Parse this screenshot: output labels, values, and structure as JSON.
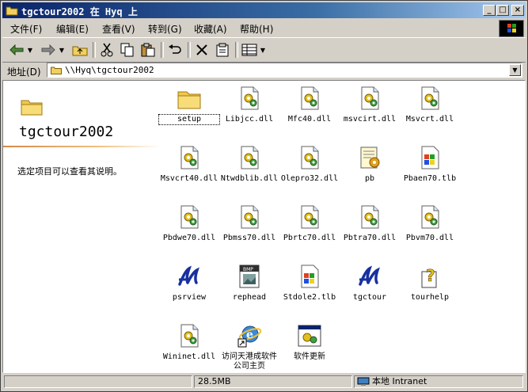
{
  "window": {
    "title": "tgctour2002 在 Hyq 上"
  },
  "menubar": {
    "items": [
      "文件(F)",
      "编辑(E)",
      "查看(V)",
      "转到(G)",
      "收藏(A)",
      "帮助(H)"
    ]
  },
  "address": {
    "label": "地址(D)",
    "path": "\\\\Hyq\\tgctour2002"
  },
  "leftpane": {
    "title": "tgctour2002",
    "description": "选定项目可以查看其说明。"
  },
  "files": [
    {
      "name": "setup",
      "icon": "folder"
    },
    {
      "name": "Libjcc.dll",
      "icon": "dll"
    },
    {
      "name": "Mfc40.dll",
      "icon": "dll"
    },
    {
      "name": "msvcirt.dll",
      "icon": "dll"
    },
    {
      "name": "Msvcrt.dll",
      "icon": "dll"
    },
    {
      "name": "Msvcrt40.dll",
      "icon": "dll"
    },
    {
      "name": "Ntwdblib.dll",
      "icon": "dll"
    },
    {
      "name": "Olepro32.dll",
      "icon": "dll"
    },
    {
      "name": "pb",
      "icon": "pb"
    },
    {
      "name": "Pbaen70.tlb",
      "icon": "tlb"
    },
    {
      "name": "Pbdwe70.dll",
      "icon": "dll"
    },
    {
      "name": "Pbmss70.dll",
      "icon": "dll"
    },
    {
      "name": "Pbrtc70.dll",
      "icon": "dll"
    },
    {
      "name": "Pbtra70.dll",
      "icon": "dll"
    },
    {
      "name": "Pbvm70.dll",
      "icon": "dll"
    },
    {
      "name": "psrview",
      "icon": "app"
    },
    {
      "name": "rephead",
      "icon": "bmp"
    },
    {
      "name": "Stdole2.tlb",
      "icon": "tlb"
    },
    {
      "name": "tgctour",
      "icon": "app"
    },
    {
      "name": "tourhelp",
      "icon": "help"
    },
    {
      "name": "Wininet.dll",
      "icon": "dll"
    },
    {
      "name": "访问天港成软件公司主页",
      "icon": "ie-shortcut"
    },
    {
      "name": "软件更新",
      "icon": "update"
    }
  ],
  "statusbar": {
    "size": "28.5MB",
    "zone": "本地 Intranet"
  },
  "colors": {
    "titlebar_start": "#0a246a",
    "titlebar_end": "#a6caf0",
    "face": "#d4d0c8"
  }
}
